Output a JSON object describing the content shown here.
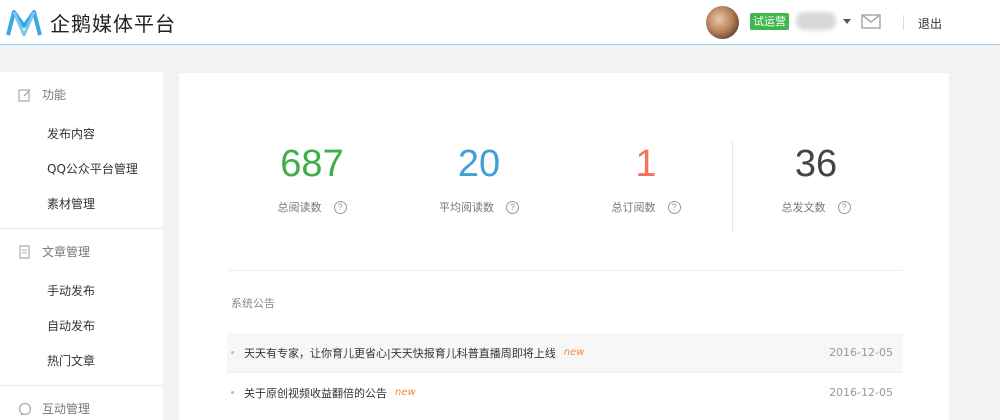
{
  "header": {
    "brand": "企鹅媒体平台",
    "trial_badge": "试运营",
    "username": "…",
    "logout": "退出",
    "accent_color": "#3aa7e5"
  },
  "sidebar": {
    "groups": [
      {
        "title": "功能",
        "icon": "edit-icon",
        "items": [
          "发布内容",
          "QQ公众平台管理",
          "素材管理"
        ]
      },
      {
        "title": "文章管理",
        "icon": "document-icon",
        "items": [
          "手动发布",
          "自动发布",
          "热门文章"
        ]
      },
      {
        "title": "互动管理",
        "icon": "chat-icon",
        "items": []
      }
    ]
  },
  "stats": [
    {
      "value": "687",
      "label": "总阅读数",
      "color": "#3fae49"
    },
    {
      "value": "20",
      "label": "平均阅读数",
      "color": "#3fa0d6"
    },
    {
      "value": "1",
      "label": "总订阅数",
      "color": "#f2735a"
    },
    {
      "value": "36",
      "label": "总发文数",
      "color": "#444444"
    }
  ],
  "notices": {
    "title": "系统公告",
    "items": [
      {
        "text": "天天有专家，让你育儿更省心|天天快报育儿科普直播周即将上线",
        "badge": "new",
        "date": "2016-12-05"
      },
      {
        "text": "关于原创视频收益翻倍的公告",
        "badge": "new",
        "date": "2016-12-05"
      }
    ]
  }
}
